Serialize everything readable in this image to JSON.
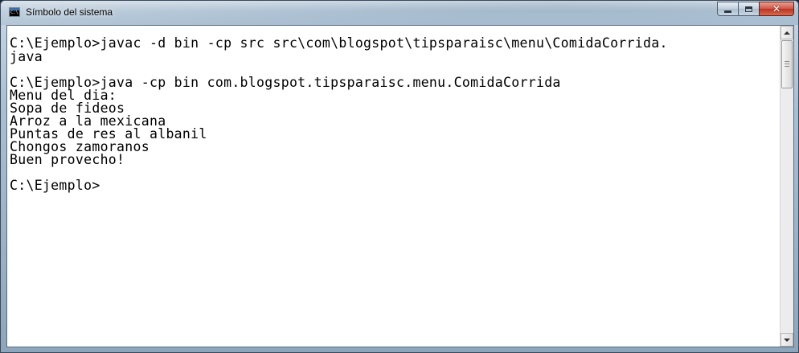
{
  "window": {
    "title": "Símbolo del sistema",
    "icon": "cmd-icon",
    "icon_text": "C:\\",
    "controls": {
      "minimize": "minimize-icon",
      "maximize": "maximize-icon",
      "close": "close-icon",
      "close_glyph": "✕"
    }
  },
  "console": {
    "lines": [
      "C:\\Ejemplo>javac -d bin -cp src src\\com\\blogspot\\tipsparaisc\\menu\\ComidaCorrida.",
      "java",
      "",
      "C:\\Ejemplo>java -cp bin com.blogspot.tipsparaisc.menu.ComidaCorrida",
      "Menu del dia:",
      "Sopa de fideos",
      "Arroz a la mexicana",
      "Puntas de res al albanil",
      "Chongos zamoranos",
      "Buen provecho!",
      "",
      "C:\\Ejemplo>"
    ]
  },
  "scrollbar": {
    "position": 0.0
  }
}
